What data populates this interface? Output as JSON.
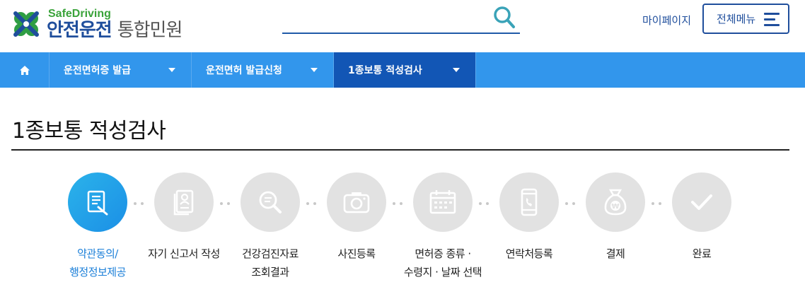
{
  "header": {
    "logo_sub": "SafeDriving",
    "logo_main": "안전운전",
    "logo_service": "통합민원",
    "mypage_label": "마이페이지",
    "menu_label": "전체메뉴"
  },
  "nav": {
    "items": [
      {
        "label": "운전면허증 발급"
      },
      {
        "label": "운전면허 발급신청"
      },
      {
        "label": "1종보통 적성검사"
      }
    ]
  },
  "page": {
    "title": "1종보통 적성검사"
  },
  "steps": [
    {
      "label": "약관동의/\n행정정보제공",
      "icon": "document-sign-icon",
      "active": true
    },
    {
      "label": "자기 신고서 작성",
      "icon": "id-document-icon",
      "active": false
    },
    {
      "label": "건강검진자료\n조회결과",
      "icon": "search-document-icon",
      "active": false
    },
    {
      "label": "사진등록",
      "icon": "camera-icon",
      "active": false
    },
    {
      "label": "면허증 종류 ·\n수령지 · 날짜 선택",
      "icon": "calendar-icon",
      "active": false
    },
    {
      "label": "연락처등록",
      "icon": "phone-icon",
      "active": false
    },
    {
      "label": "결제",
      "icon": "money-bag-icon",
      "active": false
    },
    {
      "label": "완료",
      "icon": "check-icon",
      "active": false
    }
  ],
  "colors": {
    "nav_bg": "#3296ec",
    "nav_active": "#1256b5",
    "brand_blue": "#1f4e9c",
    "brand_green": "#3aa33a",
    "step_active": "#1b8fe6",
    "step_inactive": "#e2e2e2"
  }
}
